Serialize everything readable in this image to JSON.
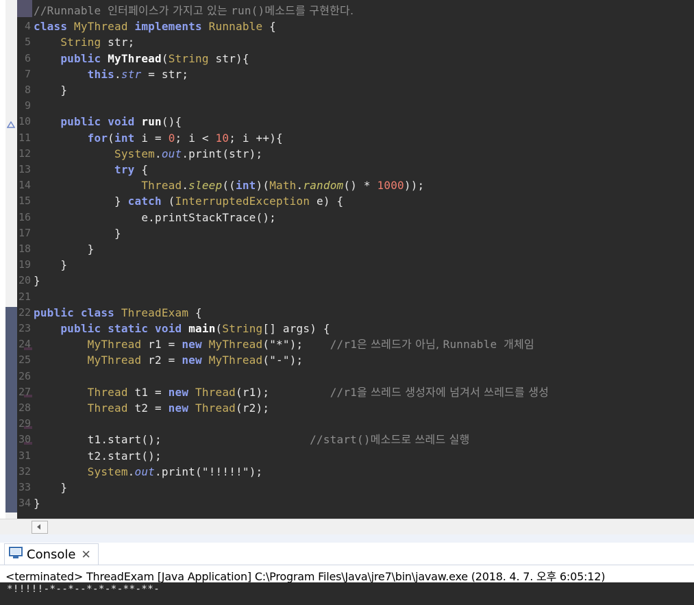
{
  "editor": {
    "lines": [
      {
        "n": "",
        "tokens": [
          {
            "t": "//Runnable ",
            "c": "cm"
          },
          {
            "t": "인터페이스가 가지고 있는 ",
            "c": "cmk"
          },
          {
            "t": "run()",
            "c": "cm"
          },
          {
            "t": "메소드를 구현한다.",
            "c": "cmk"
          }
        ]
      },
      {
        "n": "4",
        "tokens": [
          {
            "t": "class ",
            "c": "kw"
          },
          {
            "t": "MyThread ",
            "c": "ty"
          },
          {
            "t": "implements ",
            "c": "kw"
          },
          {
            "t": "Runnable",
            "c": "ty"
          },
          {
            "t": " {",
            "c": ""
          }
        ]
      },
      {
        "n": "5",
        "tokens": [
          {
            "t": "    ",
            "c": ""
          },
          {
            "t": "String",
            "c": "ty"
          },
          {
            "t": " str;",
            "c": ""
          }
        ]
      },
      {
        "n": "6",
        "tokens": [
          {
            "t": "    ",
            "c": ""
          },
          {
            "t": "public ",
            "c": "kw"
          },
          {
            "t": "MyThread",
            "c": "fn"
          },
          {
            "t": "(",
            "c": ""
          },
          {
            "t": "String",
            "c": "ty"
          },
          {
            "t": " str){",
            "c": ""
          }
        ]
      },
      {
        "n": "7",
        "tokens": [
          {
            "t": "        ",
            "c": ""
          },
          {
            "t": "this",
            "c": "kw"
          },
          {
            "t": ".",
            "c": ""
          },
          {
            "t": "str",
            "c": "fld"
          },
          {
            "t": " = str;",
            "c": ""
          }
        ]
      },
      {
        "n": "8",
        "tokens": [
          {
            "t": "    }",
            "c": ""
          }
        ]
      },
      {
        "n": "9",
        "tokens": []
      },
      {
        "n": "10",
        "tokens": [
          {
            "t": "    ",
            "c": ""
          },
          {
            "t": "public ",
            "c": "kw"
          },
          {
            "t": "void ",
            "c": "kw"
          },
          {
            "t": "run",
            "c": "fn"
          },
          {
            "t": "(){",
            "c": ""
          }
        ]
      },
      {
        "n": "11",
        "tokens": [
          {
            "t": "        ",
            "c": ""
          },
          {
            "t": "for",
            "c": "kw"
          },
          {
            "t": "(",
            "c": ""
          },
          {
            "t": "int",
            "c": "kw"
          },
          {
            "t": " i = ",
            "c": ""
          },
          {
            "t": "0",
            "c": "num"
          },
          {
            "t": "; i < ",
            "c": ""
          },
          {
            "t": "10",
            "c": "num"
          },
          {
            "t": "; i ++){",
            "c": ""
          }
        ]
      },
      {
        "n": "12",
        "tokens": [
          {
            "t": "            ",
            "c": ""
          },
          {
            "t": "System",
            "c": "ty"
          },
          {
            "t": ".",
            "c": ""
          },
          {
            "t": "out",
            "c": "fld"
          },
          {
            "t": ".print(str);",
            "c": ""
          }
        ]
      },
      {
        "n": "13",
        "tokens": [
          {
            "t": "            ",
            "c": ""
          },
          {
            "t": "try",
            "c": "kw"
          },
          {
            "t": " {",
            "c": ""
          }
        ]
      },
      {
        "n": "14",
        "tokens": [
          {
            "t": "                ",
            "c": ""
          },
          {
            "t": "Thread",
            "c": "ty"
          },
          {
            "t": ".",
            "c": ""
          },
          {
            "t": "sleep",
            "c": "smth"
          },
          {
            "t": "((",
            "c": ""
          },
          {
            "t": "int",
            "c": "kw"
          },
          {
            "t": ")(",
            "c": ""
          },
          {
            "t": "Math",
            "c": "ty"
          },
          {
            "t": ".",
            "c": ""
          },
          {
            "t": "random",
            "c": "smth"
          },
          {
            "t": "() * ",
            "c": ""
          },
          {
            "t": "1000",
            "c": "num"
          },
          {
            "t": "));",
            "c": ""
          }
        ]
      },
      {
        "n": "15",
        "tokens": [
          {
            "t": "            } ",
            "c": ""
          },
          {
            "t": "catch ",
            "c": "kw"
          },
          {
            "t": "(",
            "c": ""
          },
          {
            "t": "InterruptedException",
            "c": "ty"
          },
          {
            "t": " e) {",
            "c": ""
          }
        ]
      },
      {
        "n": "16",
        "tokens": [
          {
            "t": "                e.printStackTrace();",
            "c": ""
          }
        ]
      },
      {
        "n": "17",
        "tokens": [
          {
            "t": "            }",
            "c": ""
          }
        ]
      },
      {
        "n": "18",
        "tokens": [
          {
            "t": "        }",
            "c": ""
          }
        ]
      },
      {
        "n": "19",
        "tokens": [
          {
            "t": "    }",
            "c": ""
          }
        ]
      },
      {
        "n": "20",
        "tokens": [
          {
            "t": "}",
            "c": ""
          }
        ]
      },
      {
        "n": "21",
        "tokens": []
      },
      {
        "n": "22",
        "tokens": [
          {
            "t": "public ",
            "c": "kw"
          },
          {
            "t": "class ",
            "c": "kw"
          },
          {
            "t": "ThreadExam",
            "c": "ty"
          },
          {
            "t": " {",
            "c": ""
          }
        ]
      },
      {
        "n": "23",
        "tokens": [
          {
            "t": "    ",
            "c": ""
          },
          {
            "t": "public ",
            "c": "kw"
          },
          {
            "t": "static ",
            "c": "kw"
          },
          {
            "t": "void ",
            "c": "kw"
          },
          {
            "t": "main",
            "c": "fn"
          },
          {
            "t": "(",
            "c": ""
          },
          {
            "t": "String",
            "c": "ty"
          },
          {
            "t": "[] args) {",
            "c": ""
          }
        ]
      },
      {
        "n": "24",
        "tokens": [
          {
            "t": "        ",
            "c": ""
          },
          {
            "t": "MyThread",
            "c": "ty"
          },
          {
            "t": " r1 = ",
            "c": ""
          },
          {
            "t": "new ",
            "c": "kw"
          },
          {
            "t": "MyThread",
            "c": "ty"
          },
          {
            "t": "(",
            "c": ""
          },
          {
            "t": "\"*\"",
            "c": "str"
          },
          {
            "t": ");    ",
            "c": ""
          },
          {
            "t": "//r1",
            "c": "cm"
          },
          {
            "t": "은 쓰레드가 아님, ",
            "c": "cmk"
          },
          {
            "t": "Runnable ",
            "c": "cm"
          },
          {
            "t": "개체임",
            "c": "cmk"
          }
        ]
      },
      {
        "n": "25",
        "tokens": [
          {
            "t": "        ",
            "c": ""
          },
          {
            "t": "MyThread",
            "c": "ty"
          },
          {
            "t": " r2 = ",
            "c": ""
          },
          {
            "t": "new ",
            "c": "kw"
          },
          {
            "t": "MyThread",
            "c": "ty"
          },
          {
            "t": "(",
            "c": ""
          },
          {
            "t": "\"-\"",
            "c": "str"
          },
          {
            "t": ");",
            "c": ""
          }
        ]
      },
      {
        "n": "26",
        "tokens": []
      },
      {
        "n": "27",
        "tokens": [
          {
            "t": "        ",
            "c": ""
          },
          {
            "t": "Thread",
            "c": "ty"
          },
          {
            "t": " t1 = ",
            "c": ""
          },
          {
            "t": "new ",
            "c": "kw"
          },
          {
            "t": "Thread",
            "c": "ty"
          },
          {
            "t": "(r1);         ",
            "c": ""
          },
          {
            "t": "//r1",
            "c": "cm"
          },
          {
            "t": "을 쓰레드 생성자에 넘겨서 쓰레드를 생성",
            "c": "cmk"
          }
        ]
      },
      {
        "n": "28",
        "tokens": [
          {
            "t": "        ",
            "c": ""
          },
          {
            "t": "Thread",
            "c": "ty"
          },
          {
            "t": " t2 = ",
            "c": ""
          },
          {
            "t": "new ",
            "c": "kw"
          },
          {
            "t": "Thread",
            "c": "ty"
          },
          {
            "t": "(r2);",
            "c": ""
          }
        ]
      },
      {
        "n": "29",
        "tokens": []
      },
      {
        "n": "30",
        "tokens": [
          {
            "t": "        t1.start();                      ",
            "c": ""
          },
          {
            "t": "//start()",
            "c": "cm"
          },
          {
            "t": "메소드로 쓰레드 실행",
            "c": "cmk"
          }
        ]
      },
      {
        "n": "31",
        "tokens": [
          {
            "t": "        t2.start();",
            "c": ""
          }
        ]
      },
      {
        "n": "32",
        "tokens": [
          {
            "t": "        ",
            "c": ""
          },
          {
            "t": "System",
            "c": "ty"
          },
          {
            "t": ".",
            "c": ""
          },
          {
            "t": "out",
            "c": "fld"
          },
          {
            "t": ".print(",
            "c": ""
          },
          {
            "t": "\"!!!!!\"",
            "c": "str"
          },
          {
            "t": ");",
            "c": ""
          }
        ]
      },
      {
        "n": "33",
        "tokens": [
          {
            "t": "    }",
            "c": ""
          }
        ]
      },
      {
        "n": "34",
        "tokens": [
          {
            "t": "}",
            "c": ""
          }
        ]
      }
    ]
  },
  "console": {
    "tab_label": "Console",
    "tab_icon": "console-icon",
    "close_icon": "close-icon",
    "status_line": "<terminated> ThreadExam [Java Application] C:\\Program Files\\Java\\jre7\\bin\\javaw.exe (2018. 4. 7. 오후 6:05:12)",
    "output": "*!!!!!-*--*--*-*-*-**-**-"
  }
}
